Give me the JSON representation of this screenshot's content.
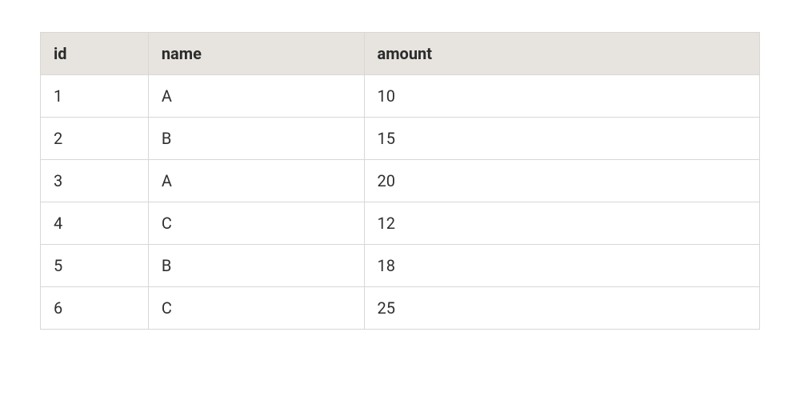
{
  "table": {
    "headers": {
      "id": "id",
      "name": "name",
      "amount": "amount"
    },
    "rows": [
      {
        "id": "1",
        "name": "A",
        "amount": "10"
      },
      {
        "id": "2",
        "name": "B",
        "amount": "15"
      },
      {
        "id": "3",
        "name": "A",
        "amount": "20"
      },
      {
        "id": "4",
        "name": "C",
        "amount": "12"
      },
      {
        "id": "5",
        "name": "B",
        "amount": "18"
      },
      {
        "id": "6",
        "name": "C",
        "amount": "25"
      }
    ]
  },
  "chart_data": {
    "type": "table",
    "columns": [
      "id",
      "name",
      "amount"
    ],
    "rows": [
      [
        1,
        "A",
        10
      ],
      [
        2,
        "B",
        15
      ],
      [
        3,
        "A",
        20
      ],
      [
        4,
        "C",
        12
      ],
      [
        5,
        "B",
        18
      ],
      [
        6,
        "C",
        25
      ]
    ]
  }
}
